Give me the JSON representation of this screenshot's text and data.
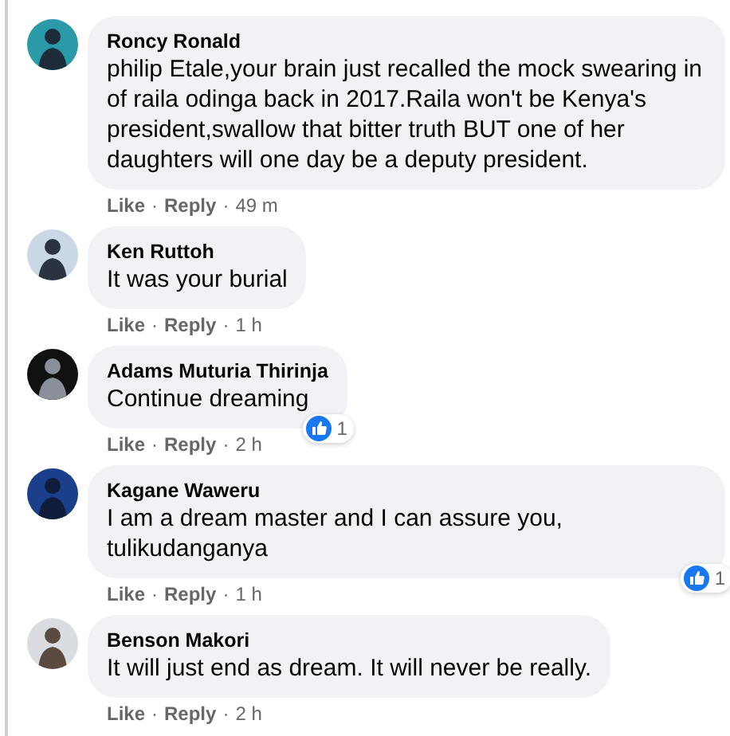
{
  "comments": [
    {
      "author": "Roncy Ronald",
      "text": "philip Etale,your brain just recalled the mock swearing in of raila odinga back in 2017.Raila won't be Kenya's president,swallow that bitter truth BUT one of her daughters will one day be a deputy president.",
      "like": "Like",
      "reply": "Reply",
      "time": "49 m",
      "separator": "·"
    },
    {
      "author": "Ken Ruttoh",
      "text": "It was your burial",
      "like": "Like",
      "reply": "Reply",
      "time": "1 h",
      "separator": "·"
    },
    {
      "author": "Adams Muturia Thirinja",
      "text": "Continue dreaming",
      "like": "Like",
      "reply": "Reply",
      "time": "2 h",
      "separator": "·",
      "reactions": "1"
    },
    {
      "author": "Kagane Waweru",
      "text": "I am a dream master and I can assure you, tulikudanganya",
      "like": "Like",
      "reply": "Reply",
      "time": "1 h",
      "separator": "·",
      "reactions": "1"
    },
    {
      "author": "Benson Makori",
      "text": "It will just end as dream. It will never be really.",
      "like": "Like",
      "reply": "Reply",
      "time": "2 h",
      "separator": "·"
    }
  ]
}
